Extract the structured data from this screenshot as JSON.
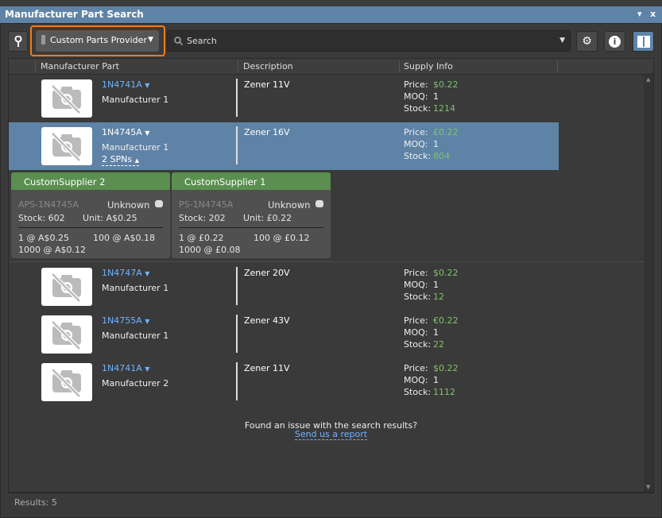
{
  "window": {
    "title": "Manufacturer Part Search",
    "menu_icon": "▾",
    "close_icon": "x"
  },
  "toolbar": {
    "provider": "Custom Parts Provider",
    "search_placeholder": "Search"
  },
  "columns": [
    "Manufacturer Part",
    "Description",
    "Supply Info"
  ],
  "supply_labels": {
    "price": "Price:",
    "moq": "MOQ:",
    "stock": "Stock:"
  },
  "rows": [
    {
      "part": "1N4741A",
      "manufacturer": "Manufacturer 1",
      "description": "Zener 11V",
      "price": "$0.22",
      "moq": "1",
      "stock": "1214",
      "selected": false
    },
    {
      "part": "1N4745A",
      "manufacturer": "Manufacturer 1",
      "description": "Zener 16V",
      "price": "£0.22",
      "moq": "1",
      "stock": "804",
      "selected": true,
      "spns": "2 SPNs"
    },
    {
      "part": "1N4747A",
      "manufacturer": "Manufacturer 1",
      "description": "Zener 20V",
      "price": "$0.22",
      "moq": "1",
      "stock": "12",
      "selected": false
    },
    {
      "part": "1N4755A",
      "manufacturer": "Manufacturer 1",
      "description": "Zener 43V",
      "price": "€0.22",
      "moq": "1",
      "stock": "22",
      "selected": false
    },
    {
      "part": "1N4741A",
      "manufacturer": "Manufacturer 2",
      "description": "Zener 11V",
      "price": "$0.22",
      "moq": "1",
      "stock": "1112",
      "selected": false
    }
  ],
  "suppliers": [
    {
      "name": "CustomSupplier 2",
      "spn": "APS-1N4745A",
      "status": "Unknown",
      "stock": "Stock: 602",
      "unit": "Unit: A$0.25",
      "breaks": [
        "1 @ A$0.25",
        "100 @ A$0.18",
        "1000 @ A$0.12"
      ]
    },
    {
      "name": "CustomSupplier 1",
      "spn": "PS-1N4745A",
      "status": "Unknown",
      "stock": "Stock: 202",
      "unit": "Unit: £0.22",
      "breaks": [
        "1 @ £0.22",
        "100 @ £0.12",
        "1000 @ £0.08"
      ]
    }
  ],
  "footer": {
    "issue": "Found an issue with the search results?",
    "report_link": "Send us a report"
  },
  "status": {
    "results": "Results: 5"
  }
}
